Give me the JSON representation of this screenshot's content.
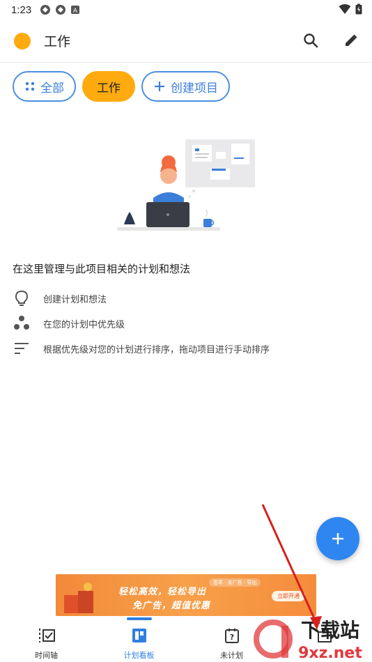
{
  "status_bar": {
    "time": "1:23"
  },
  "app_bar": {
    "title": "工作",
    "project_color": "#FFAA0F"
  },
  "chips": [
    {
      "label": "全部"
    },
    {
      "label": "工作"
    },
    {
      "label": "创建项目"
    }
  ],
  "info": {
    "title": "在这里管理与此项目相关的计划和想法",
    "items": [
      {
        "icon": "lightbulb-icon",
        "text": "创建计划和想法"
      },
      {
        "icon": "priority-dots-icon",
        "text": "在您的计划中优先级"
      },
      {
        "icon": "sort-lines-icon",
        "text": "根据优先级对您的计划进行排序，拖动项目进行手动排序"
      }
    ]
  },
  "ad": {
    "line1": "轻松高效，轻松导出",
    "line2": "免广告，超值优惠",
    "tags": "签章 · 去广告 · 导出",
    "button": "立即开通"
  },
  "bottom_nav": [
    {
      "label": "时间轴",
      "icon": "timeline-icon"
    },
    {
      "label": "计划看板",
      "icon": "board-icon",
      "active": true
    },
    {
      "label": "未计划",
      "icon": "unplanned-icon"
    },
    {
      "label": "",
      "icon": "briefcase-icon"
    }
  ],
  "watermark": {
    "text": "下载站",
    "url": "9xz.net"
  },
  "colors": {
    "accent": "#2F86F0",
    "chip_active": "#FFAA0F",
    "chip_border": "#4A8FE0"
  }
}
